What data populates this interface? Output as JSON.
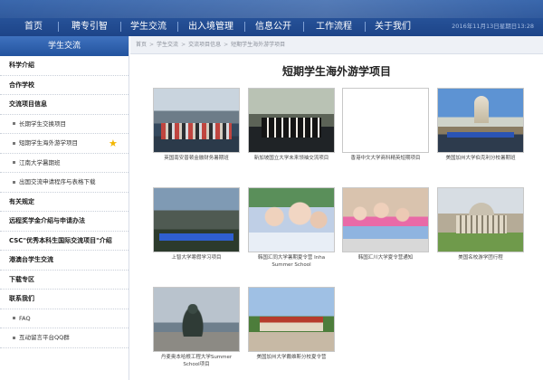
{
  "nav": {
    "items": [
      "首页",
      "聘专引智",
      "学生交流",
      "出入境管理",
      "信息公开",
      "工作流程",
      "关于我们"
    ],
    "date": "2016年11月13日星期日13:28"
  },
  "sidebar": {
    "header": "学生交流",
    "items": [
      {
        "label": "科学介绍",
        "type": "main"
      },
      {
        "label": "合作学校",
        "type": "main"
      },
      {
        "label": "交流项目信息",
        "type": "main"
      },
      {
        "label": "长期学生交换项目",
        "type": "sub"
      },
      {
        "label": "短期学生海外游学项目",
        "type": "sub",
        "active": true
      },
      {
        "label": "江南大学暑期班",
        "type": "sub"
      },
      {
        "label": "出国交流申请程序与表格下载",
        "type": "sub"
      },
      {
        "label": "有关规定",
        "type": "main"
      },
      {
        "label": "远程奖学金介绍与申请办法",
        "type": "main"
      },
      {
        "label": "CSC\"优秀本科生国际交流项目\"介绍",
        "type": "main"
      },
      {
        "label": "港澳台学生交流",
        "type": "main"
      },
      {
        "label": "下载专区",
        "type": "main"
      },
      {
        "label": "联系我们",
        "type": "main"
      },
      {
        "label": "FAQ",
        "type": "sub"
      },
      {
        "label": "互动留言平台QQ群",
        "type": "sub"
      }
    ]
  },
  "breadcrumb": [
    "首页",
    "学生交流",
    "交流项目信息",
    "短期学生海外游学项目"
  ],
  "page_title": "短期学生海外游学项目",
  "gallery": [
    {
      "caption": "英国南安普顿金融财务暑期班",
      "photo": "ph-group"
    },
    {
      "caption": "新加坡国立大学未来领袖交流项目",
      "photo": "ph-formal"
    },
    {
      "caption": "香港中文大学商科精英短期项目",
      "photo": "ph-blank"
    },
    {
      "caption": "美国加州大学伯克利分校暑期班",
      "photo": "ph-campus"
    },
    {
      "caption": "上智大学寒假学习项目",
      "photo": "ph-banner"
    },
    {
      "caption": "韩国汇同大学暑期夏令营 Inha Summer School",
      "photo": "ph-selfie"
    },
    {
      "caption": "韩国汇川大学夏令营通知",
      "photo": "ph-kids"
    },
    {
      "caption": "美国名校游学团行程",
      "photo": "ph-dome"
    },
    {
      "caption": "丹麦奥本哈根工程大学Summer School项目",
      "photo": "ph-mermaid"
    },
    {
      "caption": "美国加州大学戴维斯分校夏令营",
      "photo": "ph-rooftop"
    }
  ]
}
